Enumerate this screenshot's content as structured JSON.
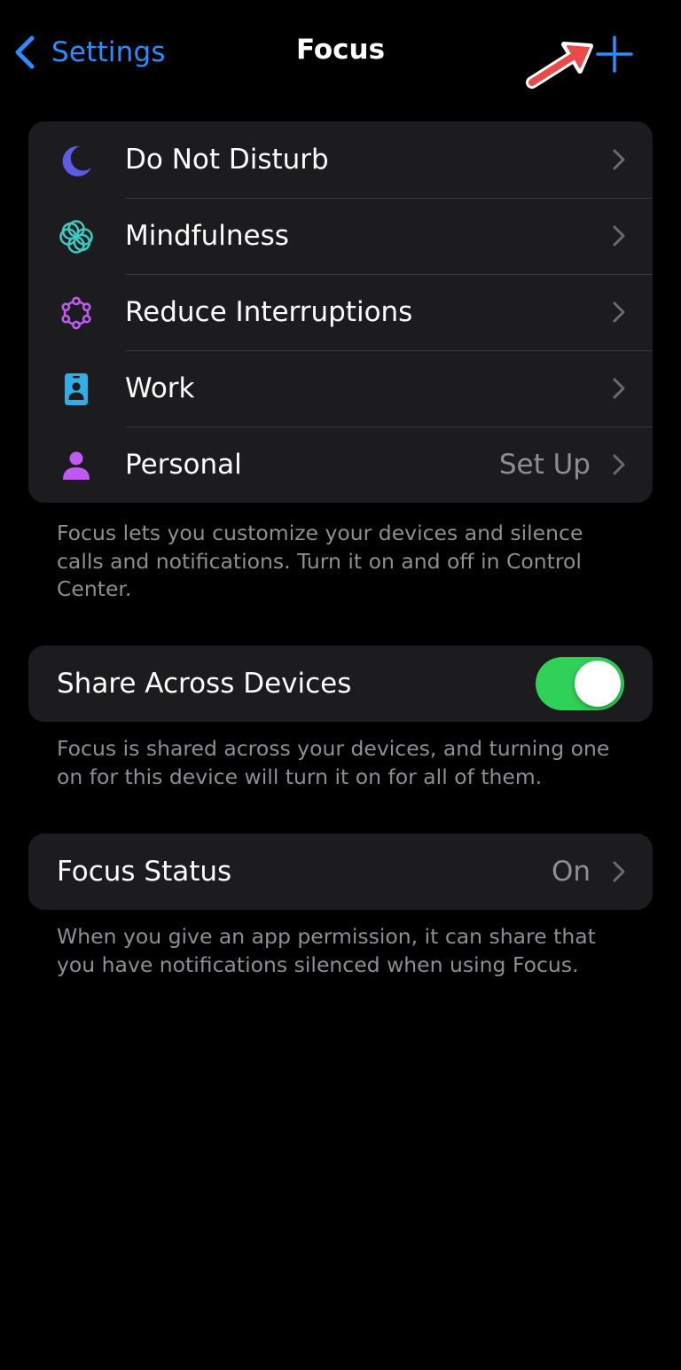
{
  "nav": {
    "back_label": "Settings",
    "title": "Focus",
    "add_icon": "plus-icon"
  },
  "focus_modes": [
    {
      "label": "Do Not Disturb",
      "icon": "moon-icon",
      "icon_color": "#5e5ce6",
      "detail": ""
    },
    {
      "label": "Mindfulness",
      "icon": "flower-icon",
      "icon_color": "#40c8c0",
      "detail": ""
    },
    {
      "label": "Reduce Interruptions",
      "icon": "interruptions-icon",
      "icon_color": "#bf5af2",
      "detail": ""
    },
    {
      "label": "Work",
      "icon": "id-badge-icon",
      "icon_color": "#32ade6",
      "detail": ""
    },
    {
      "label": "Personal",
      "icon": "person-icon",
      "icon_color": "#bf5af2",
      "detail": "Set Up"
    }
  ],
  "focus_footnote": "Focus lets you customize your devices and silence calls and notifications. Turn it on and off in Control Center.",
  "share_across_devices": {
    "label": "Share Across Devices",
    "enabled": true
  },
  "share_footnote": "Focus is shared across your devices, and turning one on for this device will turn it on for all of them.",
  "focus_status": {
    "label": "Focus Status",
    "detail": "On"
  },
  "status_footnote": "When you give an app permission, it can share that you have notifications silenced when using Focus.",
  "colors": {
    "accent": "#2d8cff",
    "toggle_on": "#30d158",
    "annotation_arrow": "#ea4a4a"
  }
}
